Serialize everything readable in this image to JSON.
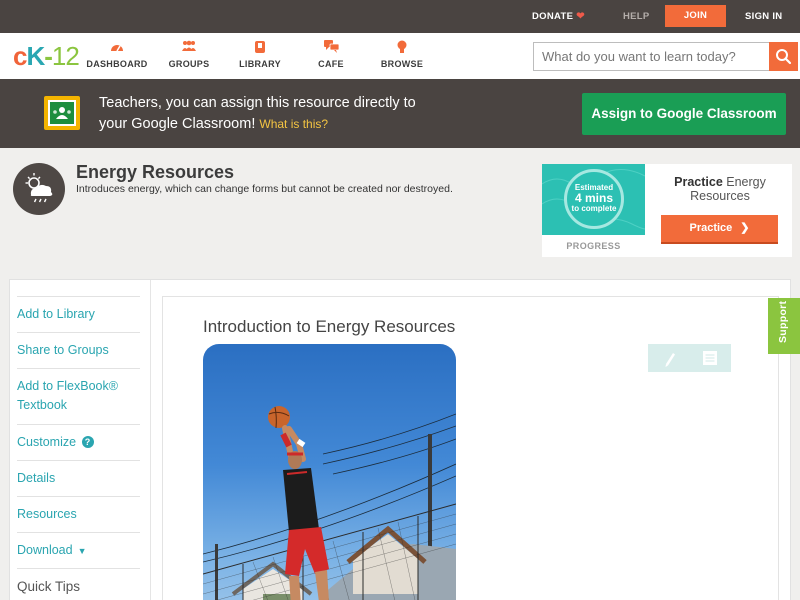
{
  "topbar": {
    "donate": "DONATE",
    "help": "HELP",
    "join": "JOIN",
    "signin": "SIGN IN"
  },
  "logo": {
    "c": "c",
    "k": "K",
    "dash": "-",
    "n": "12"
  },
  "nav": {
    "dashboard": "DASHBOARD",
    "groups": "GROUPS",
    "library": "LIBRARY",
    "cafe": "CAFE",
    "browse": "BROWSE"
  },
  "search": {
    "placeholder": "What do you want to learn today?"
  },
  "teacher_banner": {
    "line1": "Teachers, you can assign this resource directly to",
    "line2": "your Google Classroom!",
    "what_link": "What is this?",
    "assign_button": "Assign to Google Classroom"
  },
  "topic": {
    "title": "Energy Resources",
    "description": "Introduces energy, which can change forms but cannot be created nor destroyed."
  },
  "practice": {
    "estimated": "Estimated",
    "minutes": "4 mins",
    "to_complete": "to complete",
    "progress_label": "PROGRESS",
    "title_bold": "Practice",
    "title_rest": "Energy Resources",
    "button": "Practice"
  },
  "sidebar": {
    "items": [
      {
        "label": "Add to Library"
      },
      {
        "label": "Share to Groups"
      },
      {
        "label": "Add to FlexBook® Textbook"
      },
      {
        "label": "Customize"
      },
      {
        "label": "Details"
      },
      {
        "label": "Resources"
      },
      {
        "label": "Download"
      },
      {
        "label": "Quick Tips"
      }
    ]
  },
  "article": {
    "title": "Introduction to Energy Resources"
  },
  "support": {
    "label": "Support"
  },
  "colors": {
    "accent_orange": "#f26b3a",
    "teal": "#2aa5b0",
    "green": "#1a9e55",
    "support_green": "#8bc53f",
    "dark_bar": "#4a4441"
  }
}
